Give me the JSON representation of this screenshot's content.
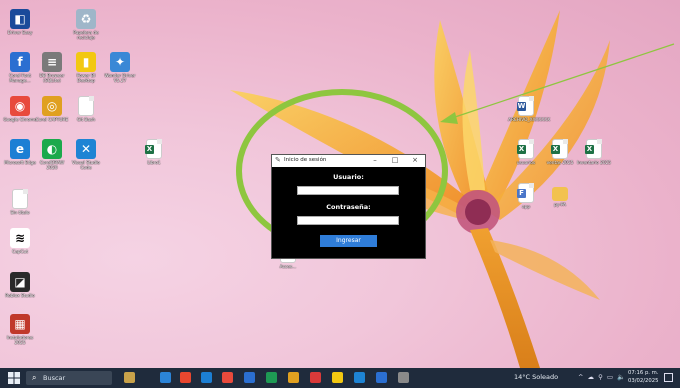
{
  "desktop_icons": [
    {
      "id": "driver-easy",
      "label": "Driver Easy",
      "color": "#1a4a9a",
      "glyph": "◧"
    },
    {
      "id": "recycle-bin",
      "label": "Papelera de reciclaje",
      "color": "#9fb6c9",
      "glyph": "♻"
    },
    {
      "id": "corel-font",
      "label": "Corel Font Manage...",
      "color": "#2b6fd1",
      "glyph": "f"
    },
    {
      "id": "db-browser",
      "label": "DB Browser (SQLite)",
      "color": "#7a7a7a",
      "glyph": "≡"
    },
    {
      "id": "power-bi",
      "label": "Power BI Desktop",
      "color": "#f2c811",
      "glyph": "▮"
    },
    {
      "id": "wonder",
      "label": "Wonder Driver V5.27",
      "color": "#3a88d6",
      "glyph": "✦"
    },
    {
      "id": "chrome",
      "label": "Google Chrome",
      "color": "#e84a3c",
      "glyph": "◉"
    },
    {
      "id": "corel-capture",
      "label": "Corel CAPTURE",
      "color": "#e0a020",
      "glyph": "◎"
    },
    {
      "id": "git-bash",
      "label": "Git Bash",
      "color": "#ffffff",
      "glyph": ""
    },
    {
      "id": "edge",
      "label": "Microsoft Edge",
      "color": "#1c7fd4",
      "glyph": "e"
    },
    {
      "id": "coreldraw",
      "label": "CorelDRAW 2020",
      "color": "#1ba94c",
      "glyph": "◐"
    },
    {
      "id": "vscode",
      "label": "Visual Studio Code",
      "color": "#1e84d4",
      "glyph": "✕"
    },
    {
      "id": "libro1",
      "label": "Libro1",
      "color": "#ffffff",
      "glyph": ""
    },
    {
      "id": "sin-titulo",
      "label": "Sin título",
      "color": "#ffffff",
      "glyph": ""
    },
    {
      "id": "capcut",
      "label": "CapCut",
      "color": "#ffffff",
      "glyph": "≋"
    },
    {
      "id": "roblox",
      "label": "Roblox Studio",
      "color": "#2a2a2a",
      "glyph": "◪"
    },
    {
      "id": "instaladores",
      "label": "Instaladores 2025",
      "color": "#c0392b",
      "glyph": "▦"
    },
    {
      "id": "word-doc",
      "label": "ARCHIVO_XXXXXXX",
      "color": "#ffffff",
      "glyph": ""
    },
    {
      "id": "excel-a",
      "label": "usuarios",
      "color": "#ffffff",
      "glyph": ""
    },
    {
      "id": "excel-b",
      "label": "ventas 2025",
      "color": "#ffffff",
      "glyph": ""
    },
    {
      "id": "excel-c",
      "label": "Inventario 2025",
      "color": "#ffffff",
      "glyph": ""
    },
    {
      "id": "file-d",
      "label": "app",
      "color": "#ffffff",
      "glyph": ""
    },
    {
      "id": "folder",
      "label": "py-PA",
      "color": "#f2c24f",
      "glyph": ""
    },
    {
      "id": "behind-window",
      "label": "Acces...",
      "color": "#ffffff",
      "glyph": ""
    }
  ],
  "window": {
    "title": "Inicio de sesión",
    "minimize": "–",
    "maximize": "□",
    "close": "×",
    "user_label": "Usuario:",
    "user_value": "",
    "password_label": "Contraseña:",
    "password_value": "",
    "login_button": "Ingresar"
  },
  "taskbar": {
    "search_placeholder": "Buscar",
    "weather": "14°C  Soleado",
    "tray": "^ ☁ ⚲ ▭ 🔈",
    "time": "07:16 p. m.",
    "date": "03/02/2025",
    "apps": [
      "#c8a24a",
      "#2b84d8",
      "#e8472f",
      "#1c7fd4",
      "#e84a3c",
      "#2b6fd1",
      "#1e9a54",
      "#e0a020",
      "#d93a3a",
      "#f2c811",
      "#1e84d4",
      "#2b6fd1",
      "#8a8a8a"
    ]
  },
  "colors": {
    "annotation_green": "#8ec63f",
    "window_bg": "#000000",
    "button_blue": "#2f7dd9"
  }
}
